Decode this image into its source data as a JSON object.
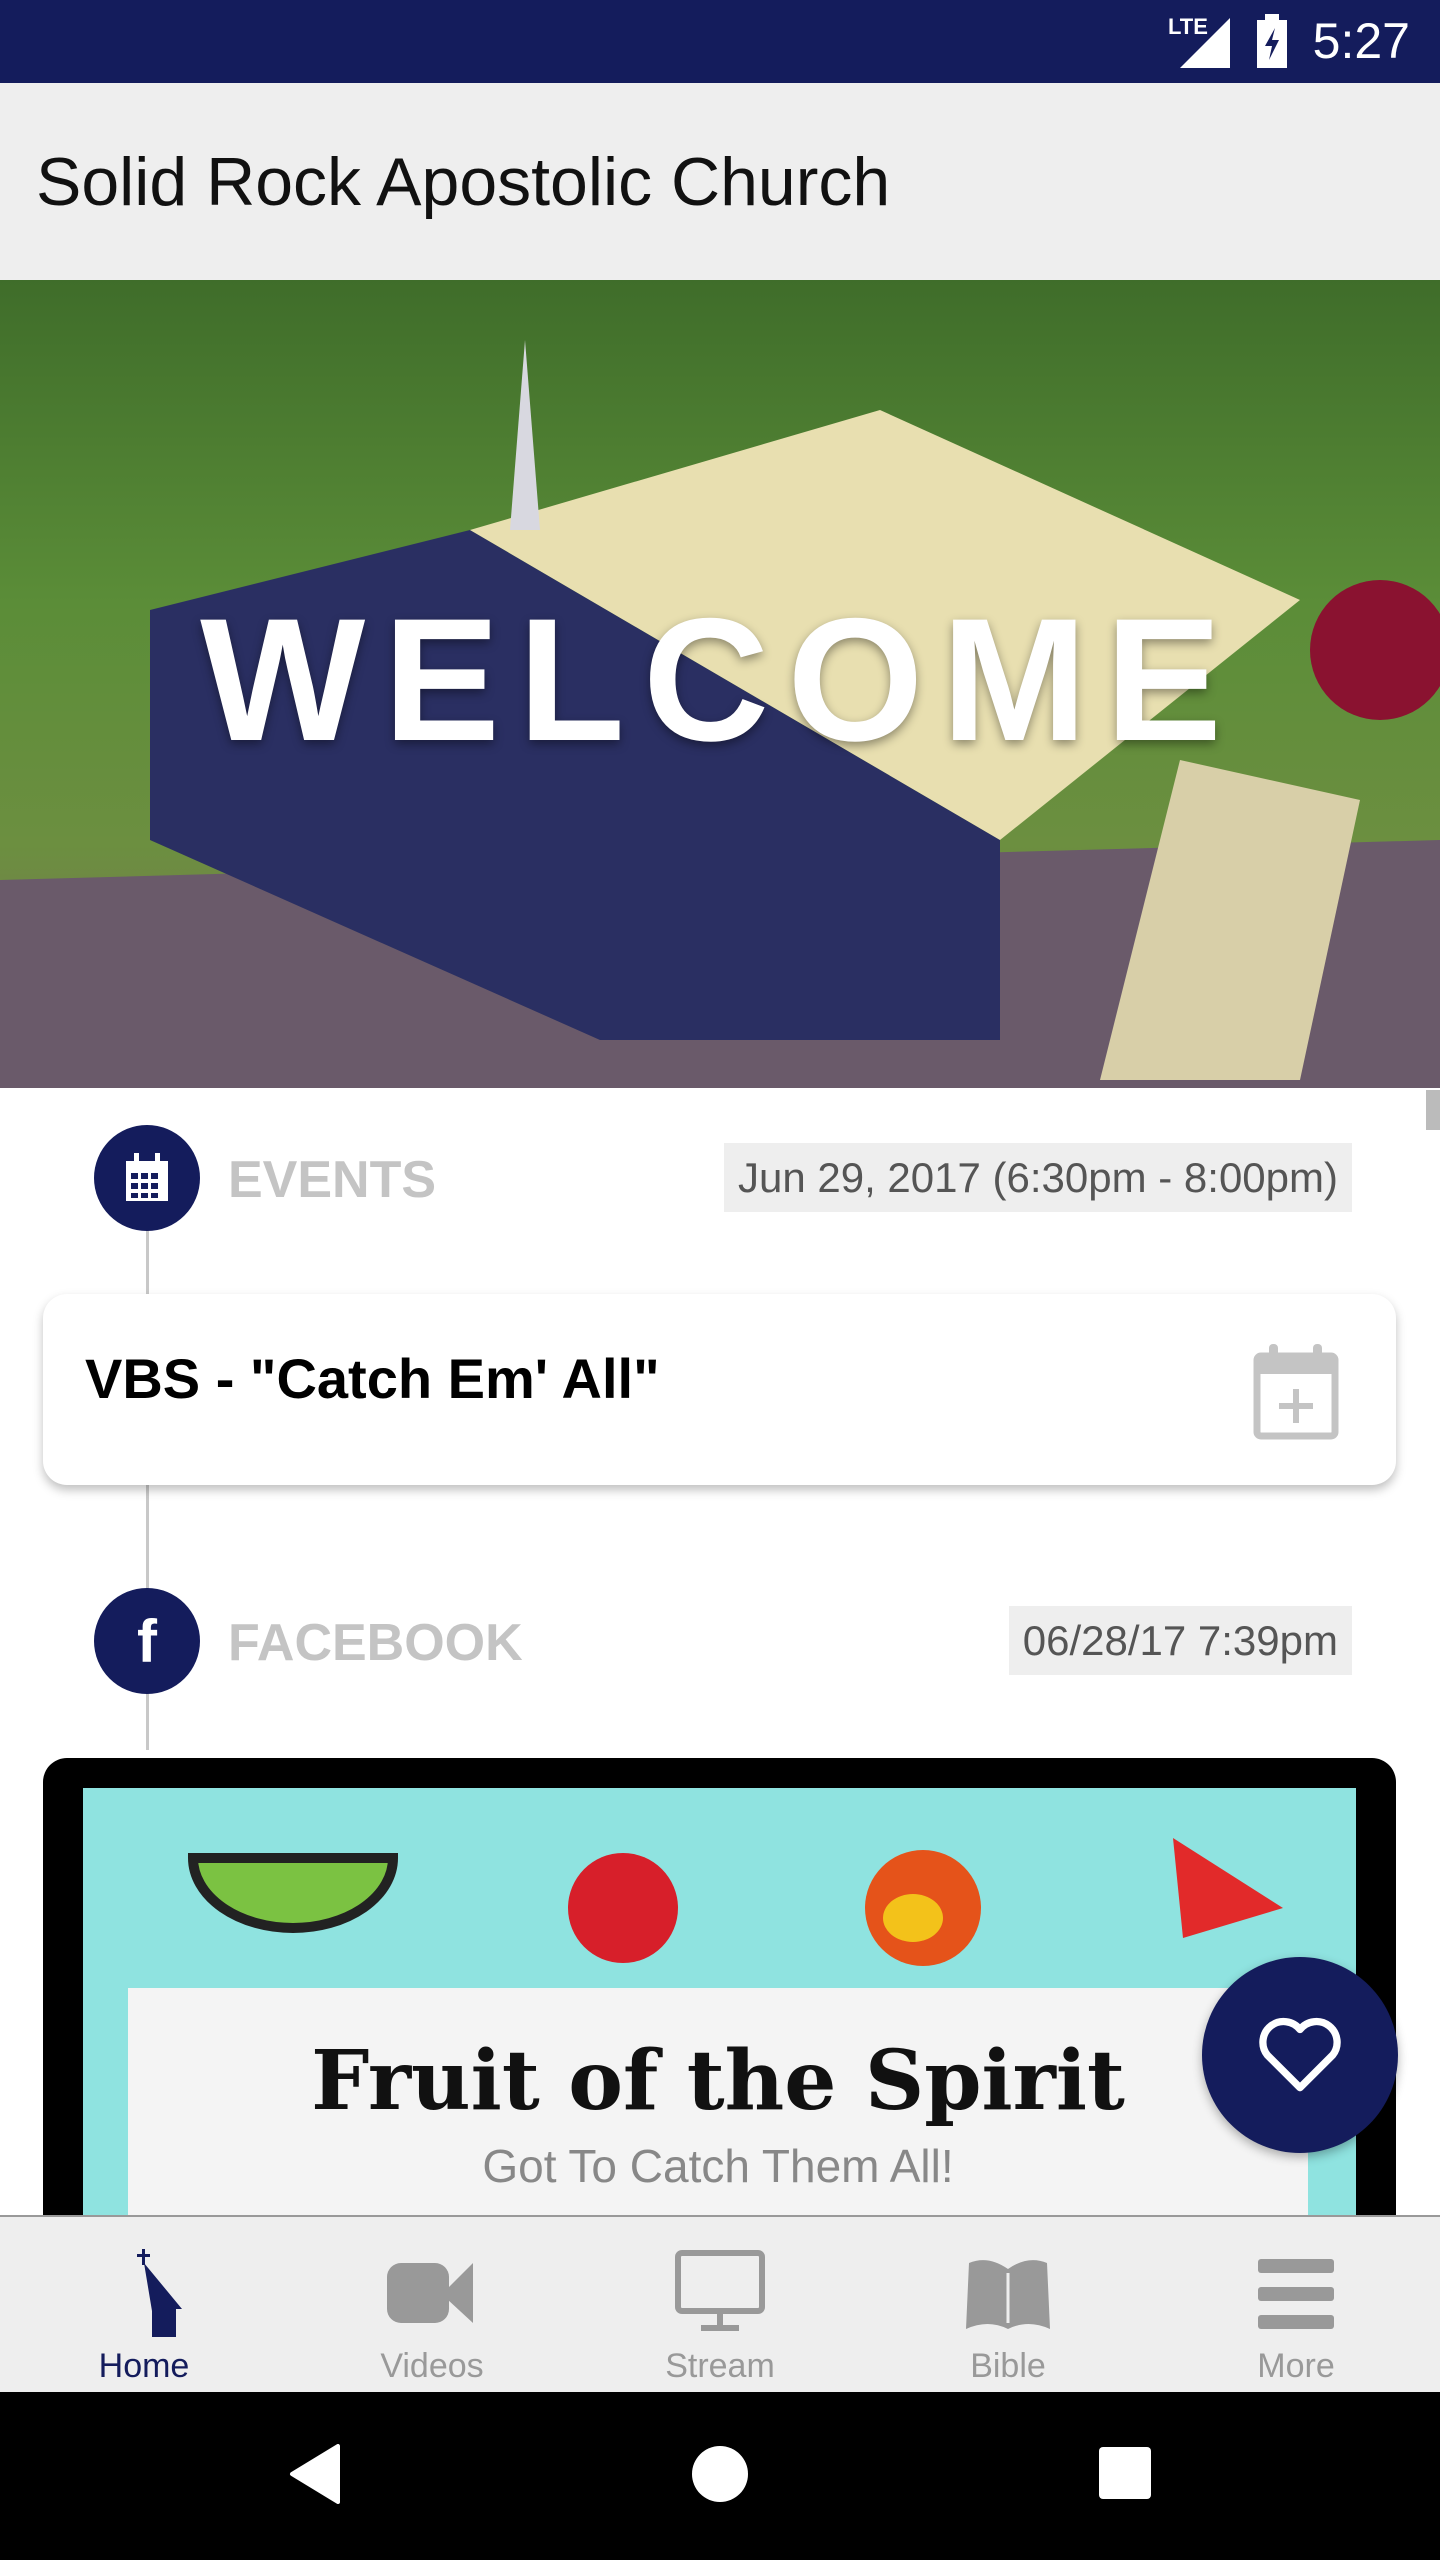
{
  "status_bar": {
    "network": "LTE",
    "time": "5:27"
  },
  "app_bar": {
    "title": "Solid Rock Apostolic Church"
  },
  "hero": {
    "text": "WELCOME"
  },
  "timeline": [
    {
      "section": "EVENTS",
      "icon": "calendar-icon",
      "date": "Jun 29, 2017 (6:30pm - 8:00pm)",
      "card_title": "VBS - \"Catch Em' All\"",
      "card_action_icon": "calendar-add-icon"
    },
    {
      "section": "FACEBOOK",
      "icon": "facebook-icon",
      "date": "06/28/17 7:39pm",
      "image_text": [
        "Fruit of the Spirit",
        "Got To Catch Them All!"
      ]
    }
  ],
  "fab": {
    "icon": "heart-icon"
  },
  "bottom_nav": [
    {
      "label": "Home",
      "icon": "church-icon",
      "active": true
    },
    {
      "label": "Videos",
      "icon": "video-camera-icon"
    },
    {
      "label": "Stream",
      "icon": "monitor-icon"
    },
    {
      "label": "Bible",
      "icon": "book-icon"
    },
    {
      "label": "More",
      "icon": "menu-icon"
    }
  ],
  "colors": {
    "primary": "#141c5c",
    "inactive": "#999999",
    "chip": "#eeeeee"
  }
}
